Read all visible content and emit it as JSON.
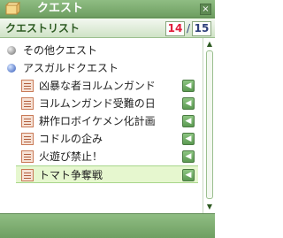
{
  "window": {
    "title": "クエスト",
    "close_glyph": "×"
  },
  "header": {
    "label": "クエストリスト",
    "count_current": "14",
    "count_separator": "/",
    "count_max": "15"
  },
  "categories": [
    {
      "label": "その他クエスト",
      "bullet": "gray"
    },
    {
      "label": "アスガルドクエスト",
      "bullet": "blue"
    }
  ],
  "quests": [
    {
      "label": "凶暴な者ヨルムンガンド",
      "selected": false
    },
    {
      "label": "ヨルムンガンド受難の日",
      "selected": false
    },
    {
      "label": "耕作ロボイケメン化計画",
      "selected": false
    },
    {
      "label": "コドルの企み",
      "selected": false
    },
    {
      "label": "火遊び禁止！",
      "selected": false
    },
    {
      "label": "トマト争奪戦",
      "selected": true
    }
  ],
  "arrow_glyph": "◀",
  "scroll": {
    "up_glyph": "▲",
    "down_glyph": "▼"
  }
}
